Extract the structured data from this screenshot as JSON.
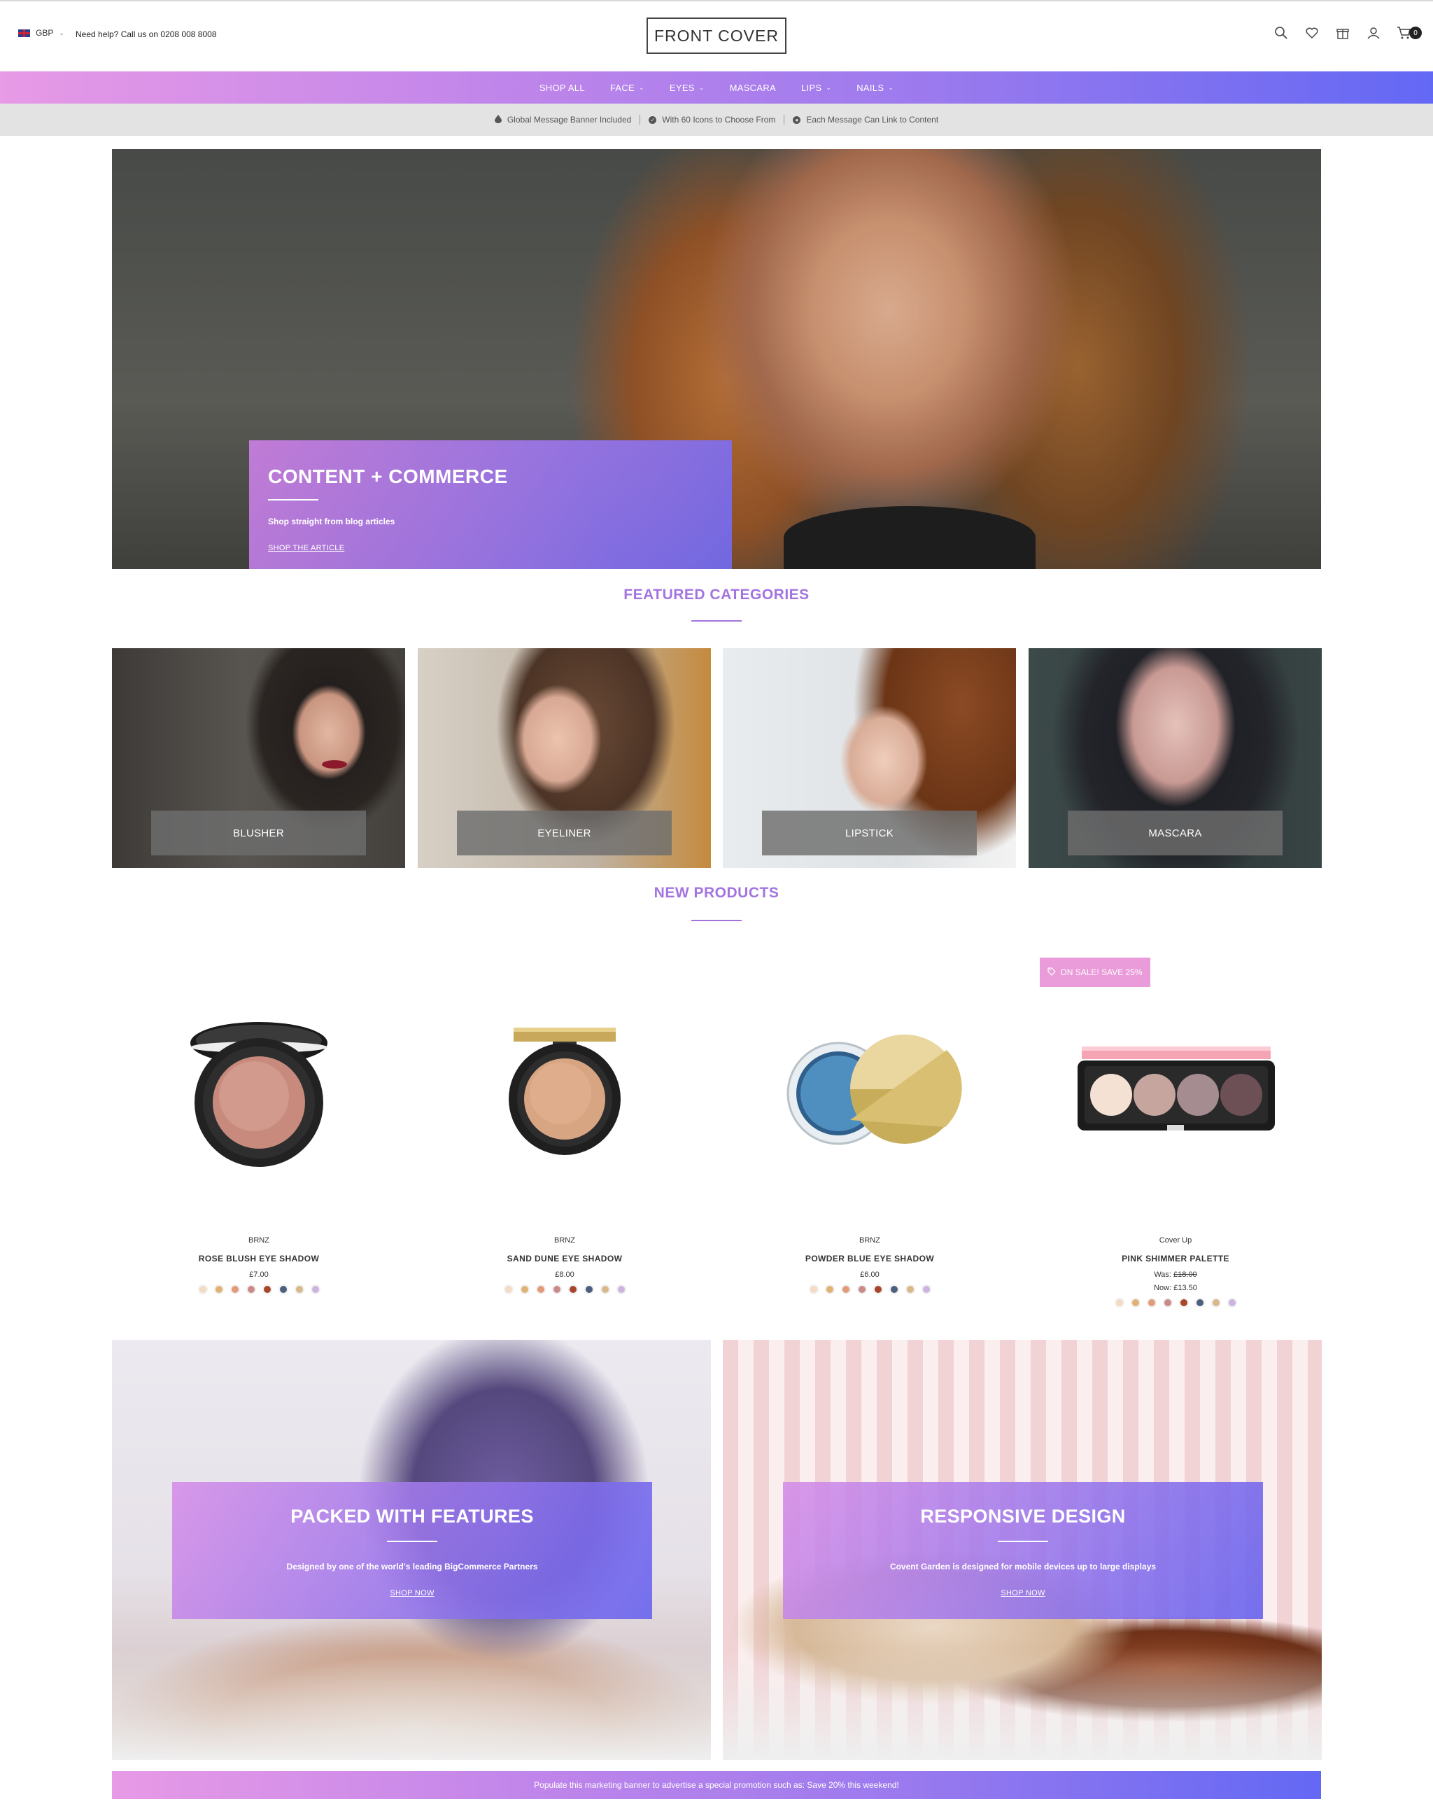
{
  "header": {
    "currency": "GBP",
    "help_text": "Need help? Call us on 0208 008 8008",
    "logo": "FRONT COVER",
    "cart_count": "0",
    "icons": [
      "search-icon",
      "heart-icon",
      "gift-icon",
      "user-icon",
      "cart-icon"
    ]
  },
  "nav": {
    "items": [
      {
        "label": "SHOP ALL",
        "dropdown": false
      },
      {
        "label": "FACE",
        "dropdown": true
      },
      {
        "label": "EYES",
        "dropdown": true
      },
      {
        "label": "MASCARA",
        "dropdown": false
      },
      {
        "label": "LIPS",
        "dropdown": true
      },
      {
        "label": "NAILS",
        "dropdown": true
      }
    ]
  },
  "messages": [
    {
      "icon": "drop-icon",
      "text": "Global Message Banner Included"
    },
    {
      "icon": "check-circle-icon",
      "text": "With 60 Icons to Choose From"
    },
    {
      "icon": "globe-icon",
      "text": "Each Message Can Link to Content"
    }
  ],
  "hero": {
    "title": "CONTENT + COMMERCE",
    "subtitle": "Shop straight from blog articles",
    "link": "SHOP THE ARTICLE"
  },
  "featured": {
    "title": "FEATURED CATEGORIES",
    "categories": [
      "BLUSHER",
      "EYELINER",
      "LIPSTICK",
      "MASCARA"
    ]
  },
  "new_products": {
    "title": "NEW PRODUCTS",
    "sale_badge": "ON SALE! SAVE 25%",
    "items": [
      {
        "brand": "BRNZ",
        "name": "ROSE BLUSH EYE SHADOW",
        "price": "£7.00"
      },
      {
        "brand": "BRNZ",
        "name": "SAND DUNE EYE SHADOW",
        "price": "£8.00"
      },
      {
        "brand": "BRNZ",
        "name": "POWDER BLUE EYE SHADOW",
        "price": "£6.00"
      },
      {
        "brand": "Cover Up",
        "name": "PINK SHIMMER PALETTE",
        "was_label": "Was:",
        "was_price": "£18.00",
        "now": "Now: £13.50"
      }
    ],
    "swatch_colors": [
      "#f4dcc4",
      "#e0b273",
      "#e39a78",
      "#c98a8a",
      "#a8452a",
      "#4d5f7e",
      "#d9b88a",
      "#cdb3e0"
    ]
  },
  "features": [
    {
      "title": "PACKED WITH FEATURES",
      "subtitle": "Designed by one of the world's leading BigCommerce Partners",
      "link": "SHOP NOW"
    },
    {
      "title": "RESPONSIVE DESIGN",
      "subtitle": "Covent Garden is designed for mobile devices up to large displays",
      "link": "SHOP NOW"
    }
  ],
  "promo": "Populate this marketing banner to advertise a special promotion such as: Save 20% this weekend!",
  "colors": {
    "accent": "#a374e0",
    "gradient_start": "#e79ae6",
    "gradient_end": "#6368f4",
    "sale_badge": "#ea9bd9"
  }
}
